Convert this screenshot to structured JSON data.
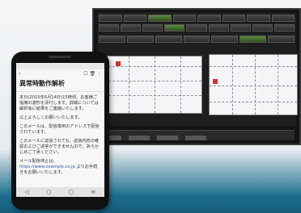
{
  "phone": {
    "status_left": "",
    "status_right": "",
    "appbar_back": "‹",
    "appbar_actions": "☐ 🗑 ⋮",
    "mail": {
      "subject": "異常時動作解析",
      "paragraphs": [
        "本日(2015年6月14日)15時頃、お客様ご指摘の波形を添付します。詳細については解析後に結果をご連絡いたします。",
        "以上よろしくお願いいたします。",
        "このメールは、配信専用のアドレスで配信されています。",
        "このメールに返信されても、返信内容の確認およびご返答ができませんので、あらかじめご了承ください。",
        "メール配信停止は、"
      ],
      "link": "https://www.example.co.jp",
      "tail": "よりお手続きをお願いいたします。"
    },
    "nav_icons": [
      "back-nav-icon",
      "home-nav-icon",
      "recent-nav-icon",
      "menu-nav-icon"
    ]
  },
  "monitor": {
    "toolbar_rows": 3
  }
}
